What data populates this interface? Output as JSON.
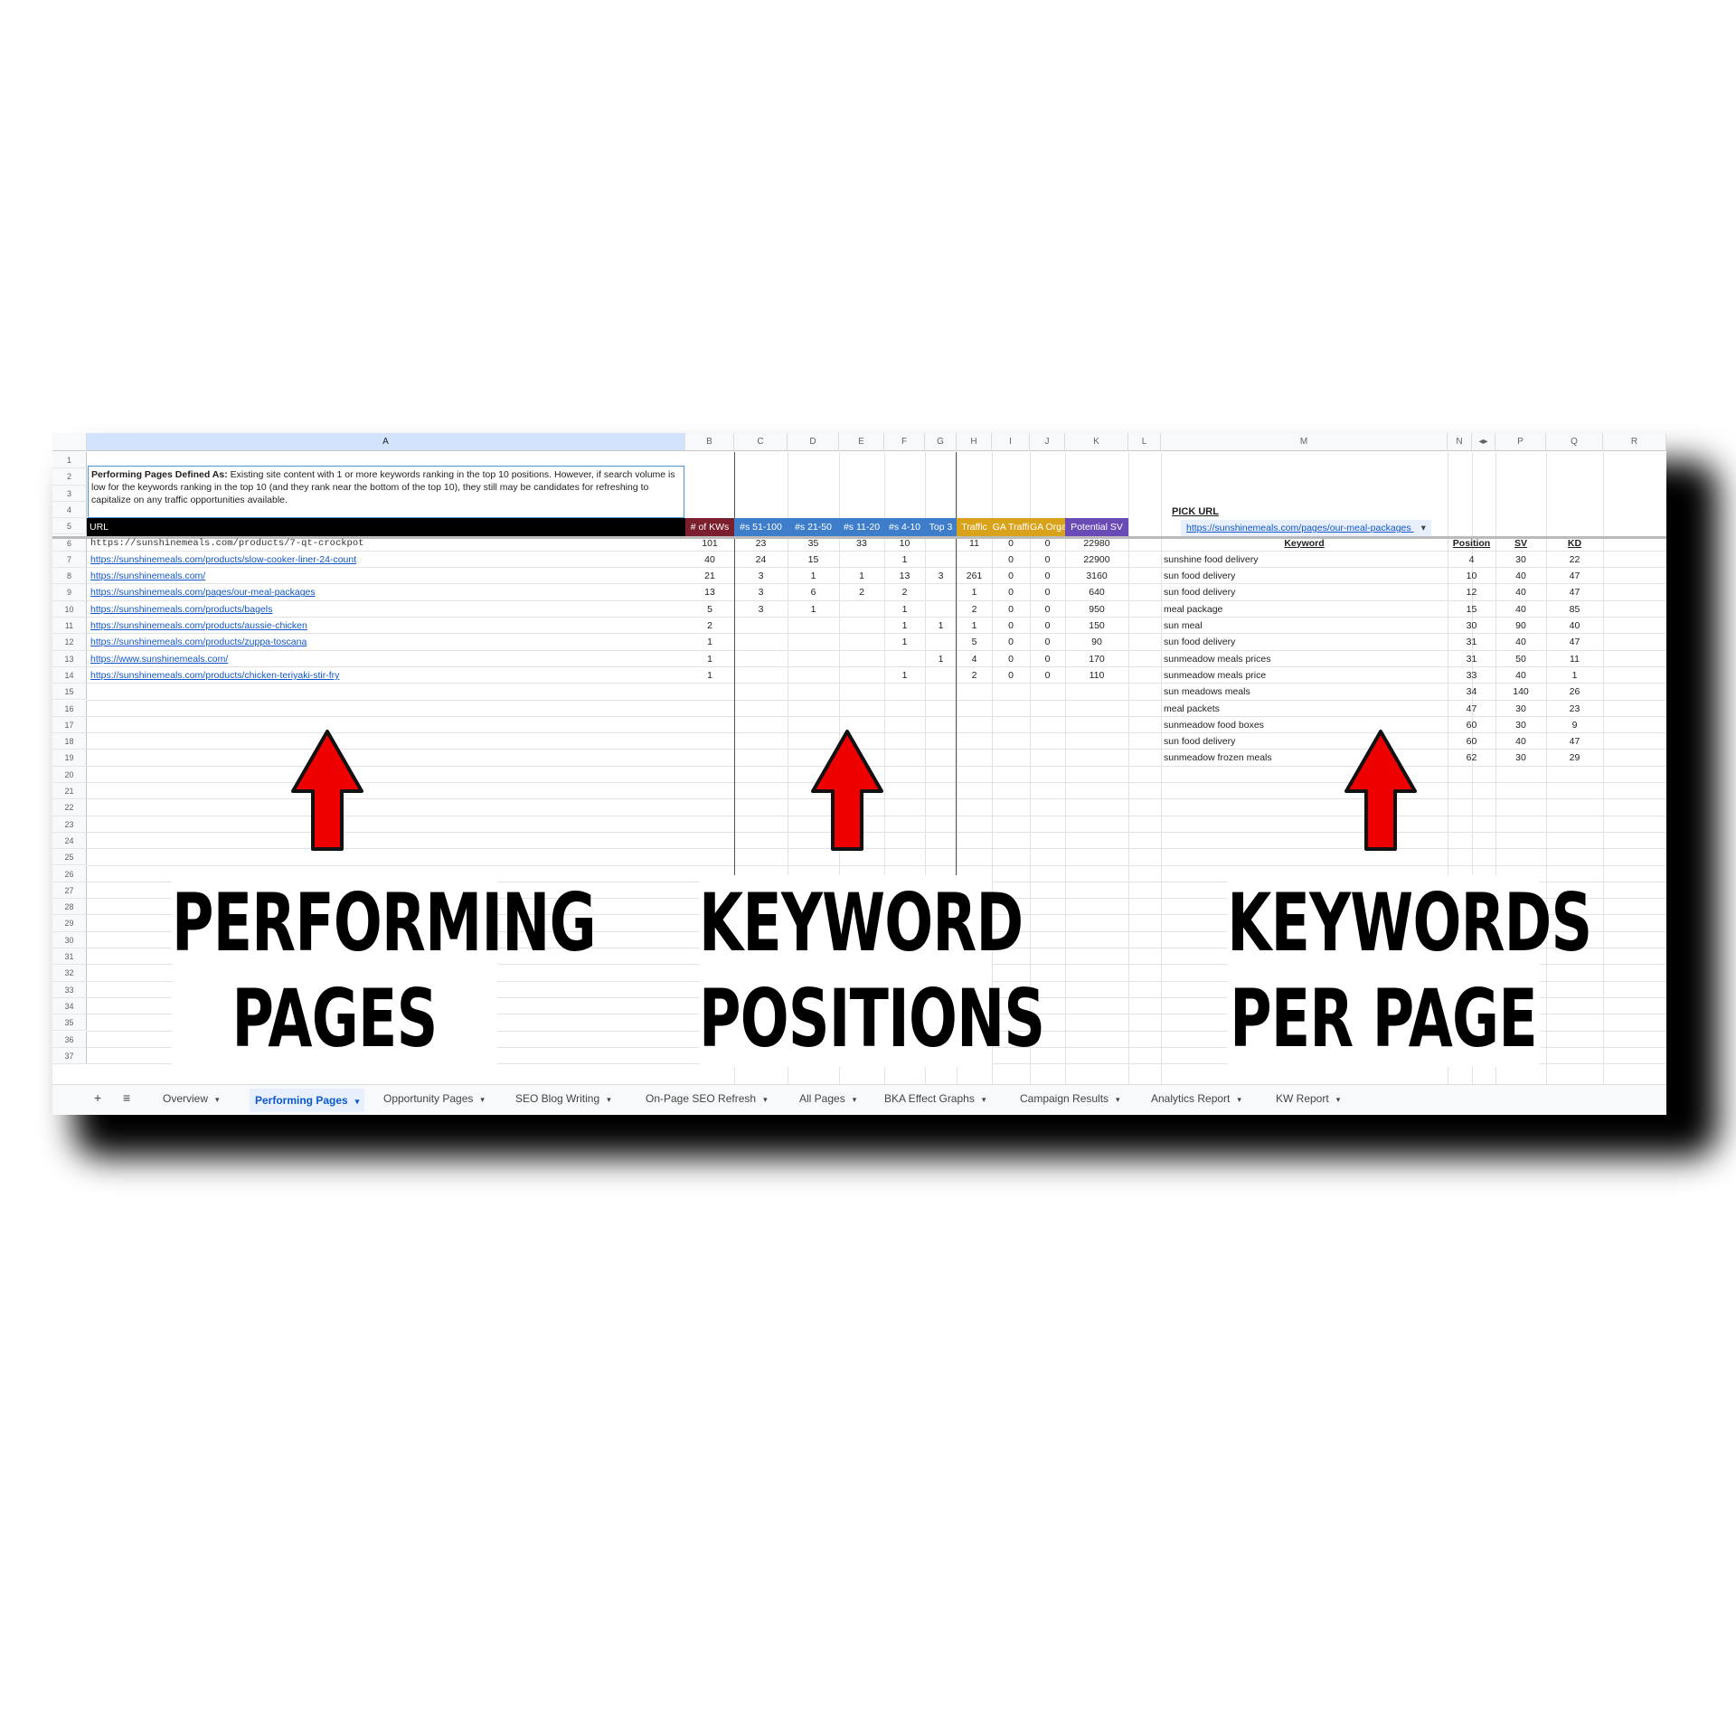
{
  "columns": [
    "A",
    "B",
    "C",
    "D",
    "E",
    "F",
    "G",
    "H",
    "I",
    "J",
    "K",
    "L",
    "M",
    "N",
    "◂▸",
    "P",
    "Q",
    "R"
  ],
  "row_numbers": [
    "1",
    "2",
    "3",
    "4",
    "5",
    "6",
    "7",
    "8",
    "9",
    "10",
    "11",
    "12",
    "13",
    "14",
    "15",
    "16",
    "17",
    "18",
    "19",
    "20",
    "21",
    "22",
    "23",
    "24",
    "25",
    "26",
    "27",
    "28",
    "29",
    "30",
    "31",
    "32",
    "33",
    "34",
    "35",
    "36",
    "37"
  ],
  "note": {
    "bold": "Performing Pages Defined As:",
    "text": " Existing site content with 1 or more keywords ranking in the top 10 positions. However, if search volume is low for the keywords ranking in the top 10 (and they rank near the bottom of the top 10), they still may be candidates for refreshing to capitalize on any traffic opportunities available."
  },
  "header_row": {
    "url": "URL",
    "kws": "# of KWs",
    "p51": "#s 51-100",
    "p21": "#s 21-50",
    "p11": "#s 11-20",
    "p4": "#s 4-10",
    "top3": "Top 3",
    "traffic": "Traffic",
    "ga_traffic": "GA Traffi",
    "ga_organic": "GA Organ",
    "potential": "Potential SV"
  },
  "header_colors": {
    "kws": "#7b1f2e",
    "positions": "#3d7dca",
    "traffic": "#d9a21b",
    "potential": "#6a4bb5",
    "url": "#000000"
  },
  "pages": [
    {
      "url": "https://sunshinemeals.com/products/7-qt-crockpot",
      "kws": "101",
      "p51": "23",
      "p21": "35",
      "p11": "33",
      "p4": "10",
      "top3": "",
      "traffic": "11",
      "ga": "0",
      "gao": "0",
      "sv": "22980"
    },
    {
      "url": "https://sunshinemeals.com/products/slow-cooker-liner-24-count",
      "kws": "40",
      "p51": "24",
      "p21": "15",
      "p11": "",
      "p4": "1",
      "top3": "",
      "traffic": "",
      "ga": "0",
      "gao": "0",
      "sv": "22900"
    },
    {
      "url": "https://sunshinemeals.com/",
      "kws": "21",
      "p51": "3",
      "p21": "1",
      "p11": "1",
      "p4": "13",
      "top3": "3",
      "traffic": "261",
      "ga": "0",
      "gao": "0",
      "sv": "3160"
    },
    {
      "url": "https://sunshinemeals.com/pages/our-meal-packages",
      "kws": "13",
      "p51": "3",
      "p21": "6",
      "p11": "2",
      "p4": "2",
      "top3": "",
      "traffic": "1",
      "ga": "0",
      "gao": "0",
      "sv": "640"
    },
    {
      "url": "https://sunshinemeals.com/products/bagels",
      "kws": "5",
      "p51": "3",
      "p21": "1",
      "p11": "",
      "p4": "1",
      "top3": "",
      "traffic": "2",
      "ga": "0",
      "gao": "0",
      "sv": "950"
    },
    {
      "url": "https://sunshinemeals.com/products/aussie-chicken",
      "kws": "2",
      "p51": "",
      "p21": "",
      "p11": "",
      "p4": "1",
      "top3": "1",
      "traffic": "1",
      "ga": "0",
      "gao": "0",
      "sv": "150"
    },
    {
      "url": "https://sunshinemeals.com/products/zuppa-toscana",
      "kws": "1",
      "p51": "",
      "p21": "",
      "p11": "",
      "p4": "1",
      "top3": "",
      "traffic": "5",
      "ga": "0",
      "gao": "0",
      "sv": "90"
    },
    {
      "url": "https://www.sunshinemeals.com/",
      "kws": "1",
      "p51": "",
      "p21": "",
      "p11": "",
      "p4": "",
      "top3": "1",
      "traffic": "4",
      "ga": "0",
      "gao": "0",
      "sv": "170"
    },
    {
      "url": "https://sunshinemeals.com/products/chicken-teriyaki-stir-fry",
      "kws": "1",
      "p51": "",
      "p21": "",
      "p11": "",
      "p4": "1",
      "top3": "",
      "traffic": "2",
      "ga": "0",
      "gao": "0",
      "sv": "110"
    }
  ],
  "pick_url": {
    "label": "PICK URL",
    "selected": "https://sunshinemeals.com/pages/our-meal-packages"
  },
  "keyword_table": {
    "headers": {
      "keyword": "Keyword",
      "position": "Position",
      "sv": "SV",
      "kd": "KD"
    },
    "rows": [
      {
        "keyword": "sunshine food delivery",
        "position": "4",
        "sv": "30",
        "kd": "22"
      },
      {
        "keyword": "sun food delivery",
        "position": "10",
        "sv": "40",
        "kd": "47"
      },
      {
        "keyword": "sun food delivery",
        "position": "12",
        "sv": "40",
        "kd": "47"
      },
      {
        "keyword": "meal package",
        "position": "15",
        "sv": "40",
        "kd": "85"
      },
      {
        "keyword": "sun meal",
        "position": "30",
        "sv": "90",
        "kd": "40"
      },
      {
        "keyword": "sun food delivery",
        "position": "31",
        "sv": "40",
        "kd": "47"
      },
      {
        "keyword": "sunmeadow meals prices",
        "position": "31",
        "sv": "50",
        "kd": "11"
      },
      {
        "keyword": "sunmeadow meals price",
        "position": "33",
        "sv": "40",
        "kd": "1"
      },
      {
        "keyword": "sun meadows meals",
        "position": "34",
        "sv": "140",
        "kd": "26"
      },
      {
        "keyword": "meal packets",
        "position": "47",
        "sv": "30",
        "kd": "23"
      },
      {
        "keyword": "sunmeadow food boxes",
        "position": "60",
        "sv": "30",
        "kd": "9"
      },
      {
        "keyword": "sun food delivery",
        "position": "60",
        "sv": "40",
        "kd": "47"
      },
      {
        "keyword": "sunmeadow frozen meals",
        "position": "62",
        "sv": "30",
        "kd": "29"
      }
    ]
  },
  "sheet_tabs": [
    "Overview",
    "Performing Pages",
    "Opportunity Pages",
    "SEO Blog Writing",
    "On-Page SEO Refresh",
    "All Pages",
    "BKA Effect Graphs",
    "Campaign Results",
    "Analytics Report",
    "KW Report"
  ],
  "active_tab": "Performing Pages",
  "tab_controls": {
    "add": "+",
    "menu": "≡",
    "caret": "▾"
  },
  "callouts": [
    {
      "line1": "PERFORMING",
      "line2": "PAGES"
    },
    {
      "line1": "KEYWORD",
      "line2": "POSITIONS"
    },
    {
      "line1": "KEYWORDS",
      "line2": "PER PAGE"
    }
  ],
  "arrow_color": "#ee0000"
}
